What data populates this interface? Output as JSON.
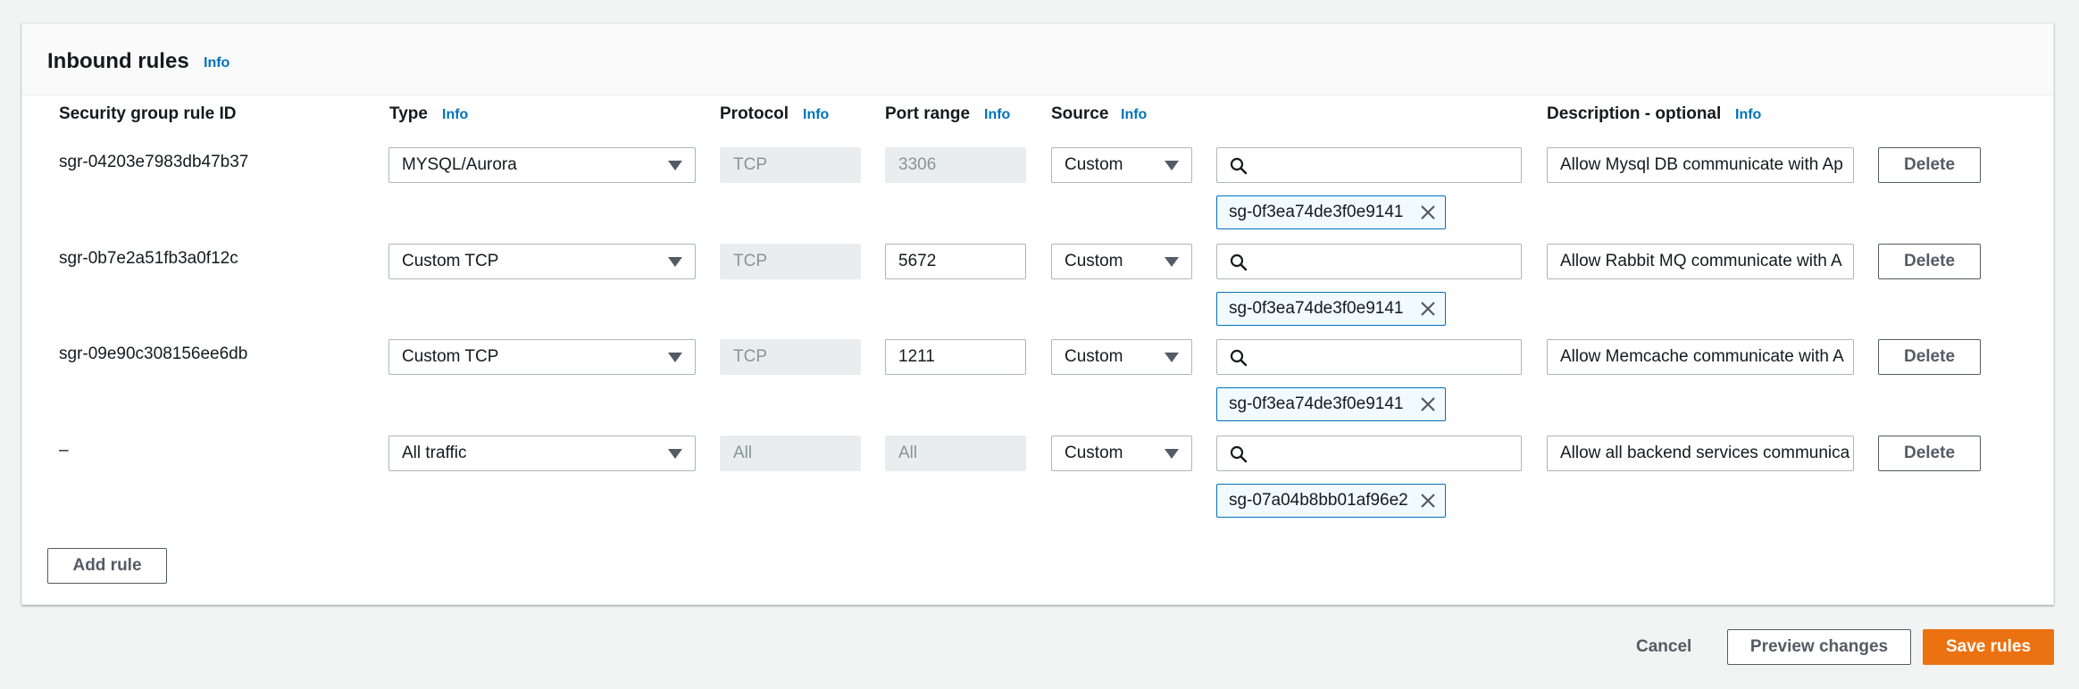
{
  "panel": {
    "title": "Inbound rules",
    "info": "Info"
  },
  "columns": {
    "rule_id": "Security group rule ID",
    "type": "Type",
    "protocol": "Protocol",
    "port_range": "Port range",
    "source": "Source",
    "description": "Description - optional",
    "info": "Info"
  },
  "rules": [
    {
      "id": "sgr-04203e7983db47b37",
      "type": "MYSQL/Aurora",
      "protocol": "TCP",
      "port": "3306",
      "port_editable": false,
      "source": "Custom",
      "token": "sg-0f3ea74de3f0e9141",
      "description": "Allow Mysql DB communicate with Ap"
    },
    {
      "id": "sgr-0b7e2a51fb3a0f12c",
      "type": "Custom TCP",
      "protocol": "TCP",
      "port": "5672",
      "port_editable": true,
      "source": "Custom",
      "token": "sg-0f3ea74de3f0e9141",
      "description": "Allow Rabbit MQ communicate with A"
    },
    {
      "id": "sgr-09e90c308156ee6db",
      "type": "Custom TCP",
      "protocol": "TCP",
      "port": "1211",
      "port_editable": true,
      "source": "Custom",
      "token": "sg-0f3ea74de3f0e9141",
      "description": "Allow Memcache communicate with A"
    },
    {
      "id": "–",
      "type": "All traffic",
      "protocol": "All",
      "port": "All",
      "port_editable": false,
      "source": "Custom",
      "token": "sg-07a04b8bb01af96e2",
      "description": "Allow all backend services communica"
    }
  ],
  "buttons": {
    "delete": "Delete",
    "add_rule": "Add rule",
    "cancel": "Cancel",
    "preview": "Preview changes",
    "save": "Save rules"
  },
  "icons": {
    "search": "search-icon",
    "remove": "close-icon",
    "dropdown": "caret-down-icon"
  },
  "colors": {
    "link": "#0073bb",
    "primary": "#ec7211",
    "token_border": "#0073bb"
  }
}
